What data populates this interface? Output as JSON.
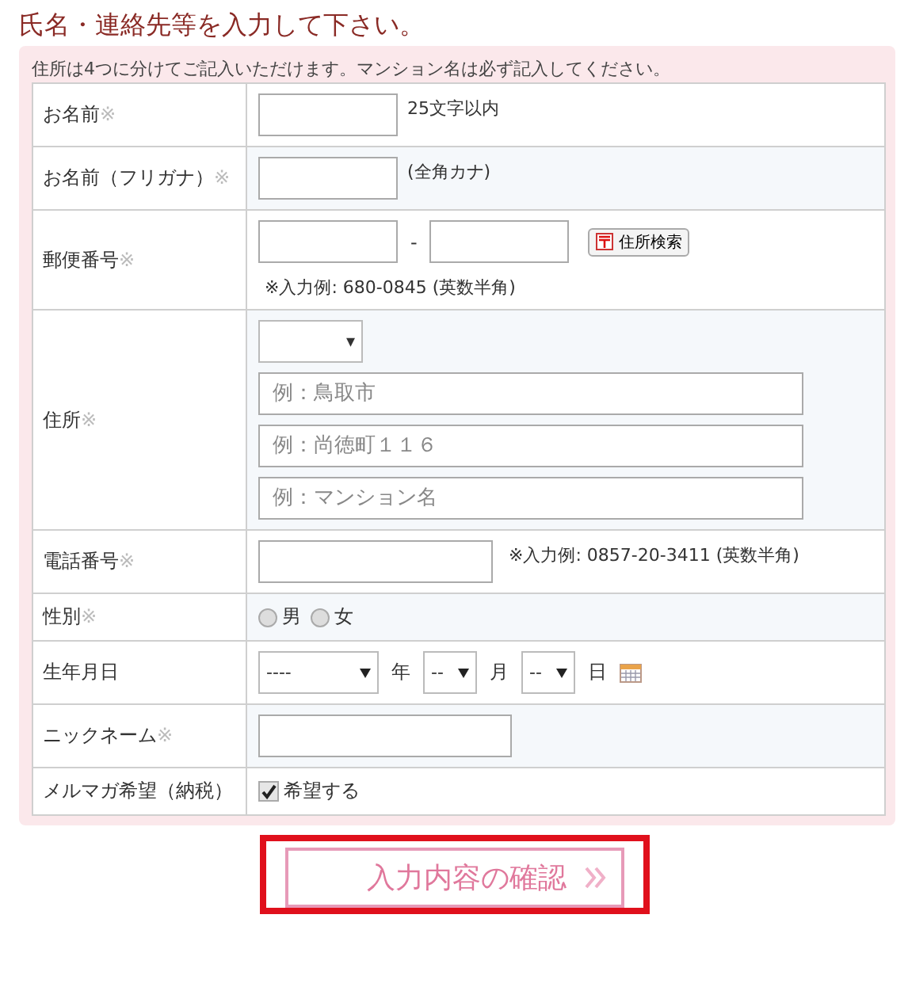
{
  "heading": "氏名・連絡先等を入力して下さい。",
  "note": "住所は4つに分けてご記入いただけます。マンション名は必ず記入してください。",
  "rows": [
    {
      "label": "お名前",
      "mark": "※",
      "controls": [
        {
          "kind": "short-input"
        },
        {
          "kind": "hint",
          "text": "25文字以内"
        }
      ]
    },
    {
      "label": "お名前（フリガナ）",
      "mark": "※",
      "controls": [
        {
          "kind": "short-input"
        },
        {
          "kind": "hint",
          "text": "(全角カナ)"
        }
      ]
    },
    {
      "label": "郵便番号",
      "mark": "※",
      "controls": [
        {
          "kind": "short-input"
        },
        {
          "kind": "text",
          "text": "-"
        },
        {
          "kind": "short-input"
        },
        {
          "kind": "button",
          "text": "住所検索"
        },
        {
          "kind": "break"
        },
        {
          "kind": "note",
          "text": "※入力例: 680-0845 (英数半角)"
        }
      ]
    },
    {
      "label": "住所",
      "mark": "※",
      "controls": [
        {
          "kind": "pref-select",
          "value": "▾"
        },
        {
          "kind": "break"
        },
        {
          "kind": "long-input",
          "placeholder": "例：鳥取市"
        },
        {
          "kind": "break"
        },
        {
          "kind": "long-input",
          "placeholder": "例：尚徳町１１６"
        },
        {
          "kind": "break"
        },
        {
          "kind": "long-input",
          "placeholder": "例：マンション名"
        }
      ]
    },
    {
      "label": "電話番号",
      "mark": "※",
      "controls": [
        {
          "kind": "medium-input"
        },
        {
          "kind": "note",
          "text": "※入力例: 0857-20-3411 (英数半角)"
        }
      ]
    },
    {
      "label": "性別",
      "mark": "※",
      "controls": [
        {
          "kind": "radio",
          "label": "男",
          "selected": false
        },
        {
          "kind": "radio",
          "label": "女",
          "selected": false
        }
      ]
    },
    {
      "label": "生年月日",
      "controls": [
        {
          "kind": "year-select",
          "value": "----"
        },
        {
          "kind": "text",
          "text": "年"
        },
        {
          "kind": "day-select",
          "value": "--"
        },
        {
          "kind": "text",
          "text": "月"
        },
        {
          "kind": "day-select",
          "value": "--"
        },
        {
          "kind": "text",
          "text": "日"
        },
        {
          "kind": "calendar"
        }
      ]
    },
    {
      "label": "ニックネーム",
      "mark": "※",
      "controls": [
        {
          "kind": "wide-input"
        }
      ]
    },
    {
      "label": "メルマガ希望（納税）",
      "controls": [
        {
          "kind": "checkbox",
          "label": "希望する",
          "checked": true
        }
      ]
    }
  ],
  "submit": {
    "label": "入力内容の確認",
    "highlighted": true
  }
}
